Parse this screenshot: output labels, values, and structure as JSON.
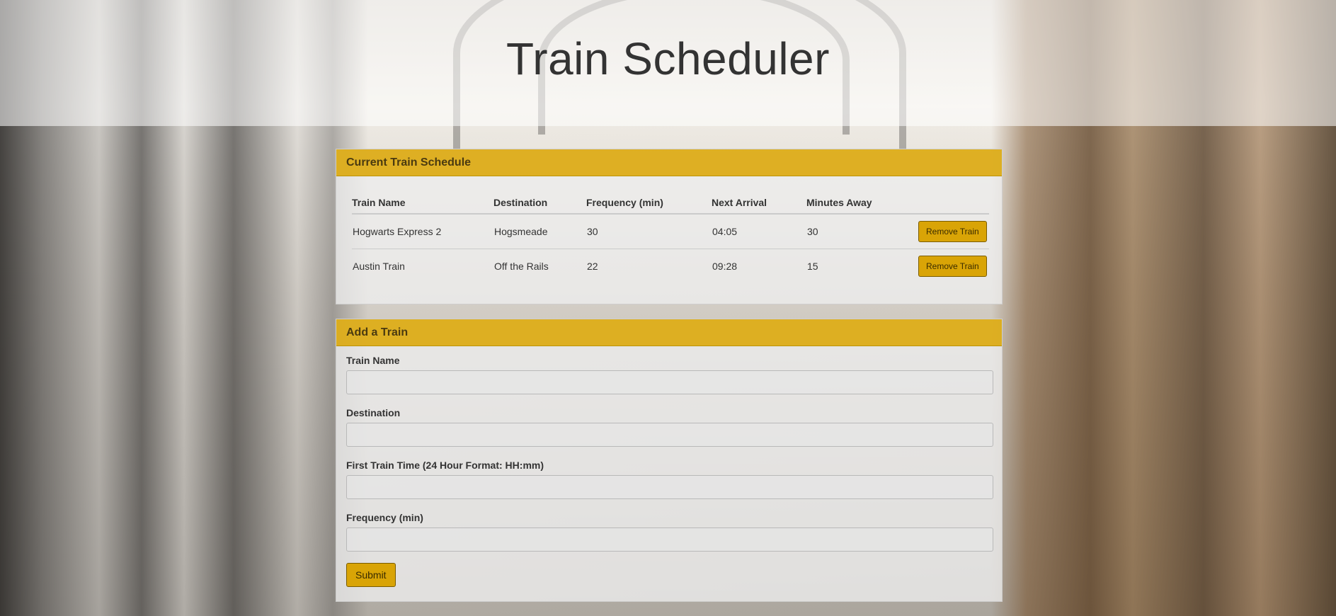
{
  "header": {
    "title": "Train Scheduler"
  },
  "schedule": {
    "heading": "Current Train Schedule",
    "columns": [
      "Train Name",
      "Destination",
      "Frequency (min)",
      "Next Arrival",
      "Minutes Away"
    ],
    "rows": [
      {
        "name": "Hogwarts Express 2",
        "destination": "Hogsmeade",
        "frequency": "30",
        "next_arrival": "04:05",
        "minutes_away": "30",
        "action_label": "Remove Train"
      },
      {
        "name": "Austin Train",
        "destination": "Off the Rails",
        "frequency": "22",
        "next_arrival": "09:28",
        "minutes_away": "15",
        "action_label": "Remove Train"
      }
    ]
  },
  "add_train": {
    "heading": "Add a Train",
    "fields": [
      {
        "label": "Train Name",
        "value": "",
        "placeholder": ""
      },
      {
        "label": "Destination",
        "value": "",
        "placeholder": ""
      },
      {
        "label": "First Train Time (24 Hour Format: HH:mm)",
        "value": "",
        "placeholder": ""
      },
      {
        "label": "Frequency (min)",
        "value": "",
        "placeholder": ""
      }
    ],
    "submit_label": "Submit"
  },
  "colors": {
    "accent": "#d9a406",
    "panel_heading": "#daa500",
    "title_text": "#333333"
  }
}
